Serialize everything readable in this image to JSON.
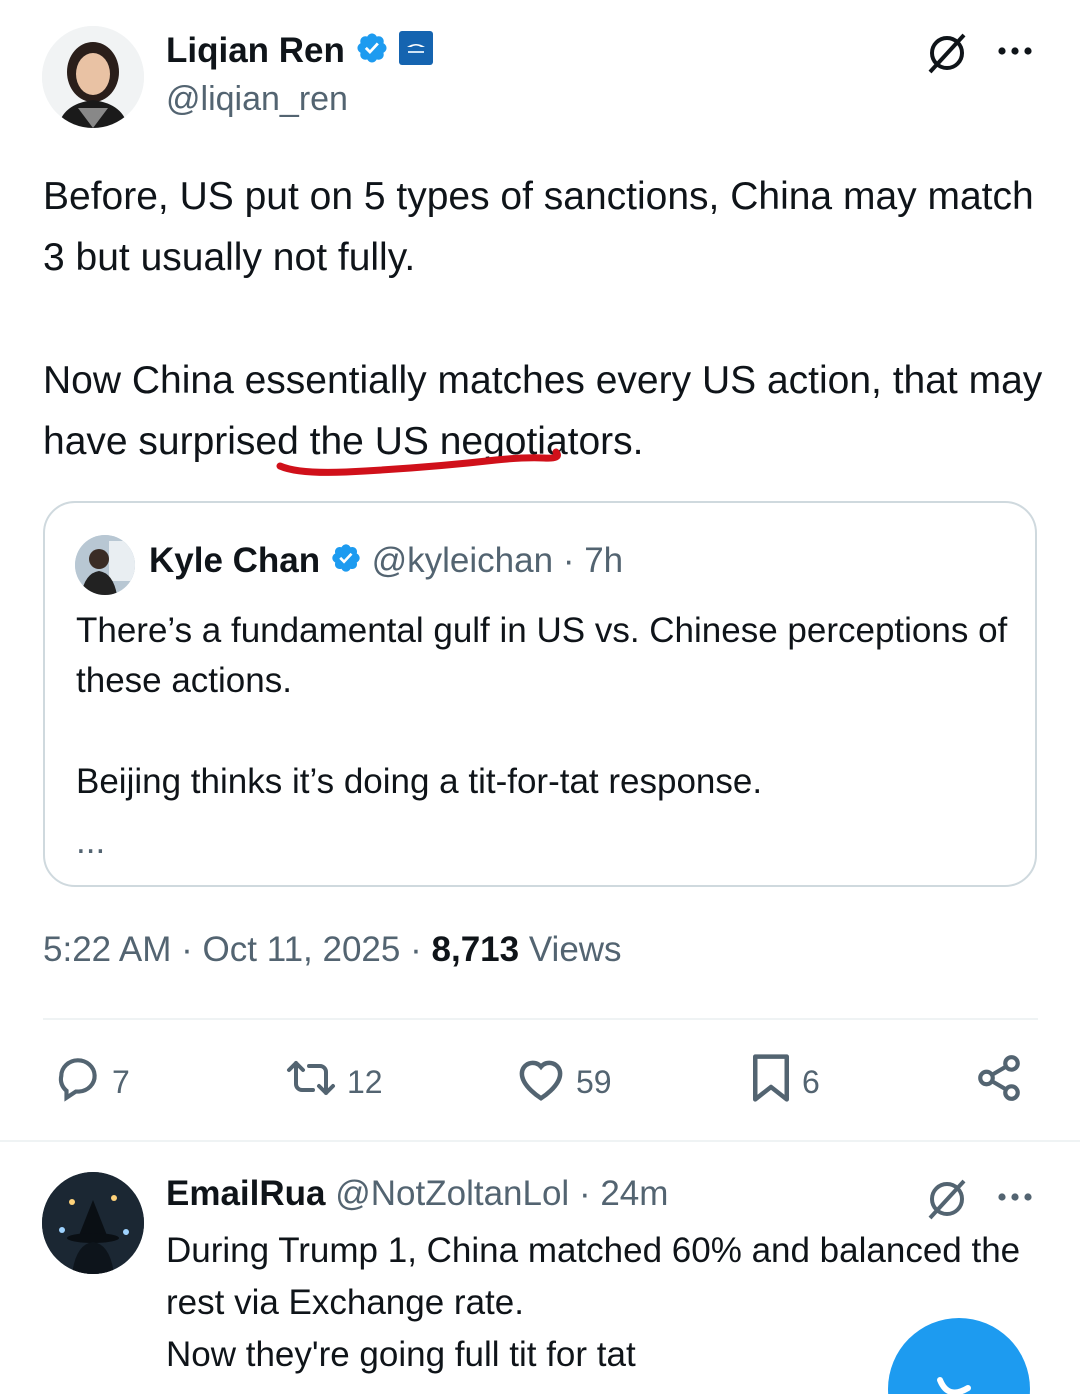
{
  "tweet": {
    "author_name": "Liqian Ren",
    "author_handle": "@liqian_ren",
    "paragraph_1": "Before, US put on 5 types of sanctions, China may match 3 but usually not fully.",
    "paragraph_2": "Now China essentially matches every US action, that may have surprised the US negotiators.",
    "time": "5:22 AM",
    "date": "Oct 11, 2025",
    "views_count": "8,713",
    "views_label": "Views"
  },
  "quoted": {
    "author_name": "Kyle Chan",
    "author_handle": "@kyleichan",
    "time_ago": "7h",
    "text_1": "There’s a fundamental gulf in US vs. Chinese perceptions of these actions.",
    "text_2": "Beijing thinks it’s doing a tit-for-tat response.",
    "text_3": "..."
  },
  "actions": {
    "replies": "7",
    "reposts": "12",
    "likes": "59",
    "bookmarks": "6"
  },
  "reply": {
    "author_name": "EmailRua",
    "author_handle": "@NotZoltanLol",
    "time_ago": "24m",
    "line_1": "During Trump 1, China matched 60% and balanced the rest via Exchange rate.",
    "line_2": "Now they're going full tit for tat"
  },
  "icons": {
    "verified": "verified-badge-icon",
    "grok": "grok-icon",
    "more": "more-icon",
    "reply": "reply-icon",
    "repost": "repost-icon",
    "like": "heart-icon",
    "bookmark": "bookmark-icon",
    "share": "share-icon"
  },
  "colors": {
    "verified_blue": "#1d9bf0",
    "text": "#0f1419",
    "secondary": "#536471",
    "underline_annotation": "#d0101a"
  }
}
